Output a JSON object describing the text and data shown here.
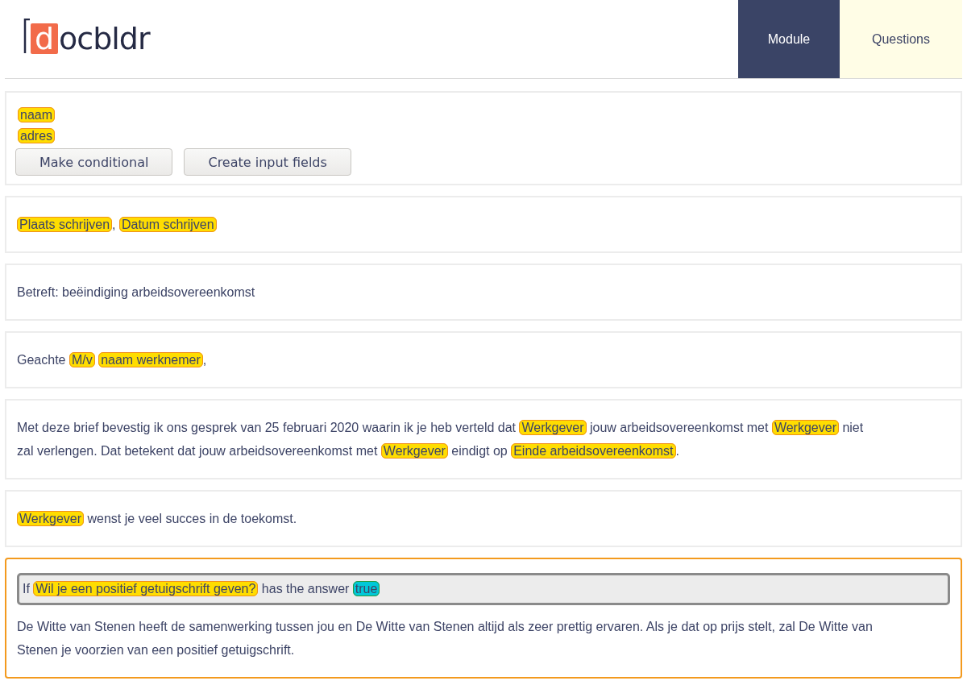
{
  "logo": {
    "mark": "d",
    "text": "ocbldr"
  },
  "tabs": [
    {
      "label": "Module",
      "selected": true
    },
    {
      "label": "Questions",
      "selected": false
    }
  ],
  "blocks": [
    {
      "kind": "fields",
      "selected": false,
      "tags": [
        "naam",
        "adres"
      ],
      "buttons": [
        "Make conditional",
        "Create input fields"
      ]
    },
    {
      "kind": "paragraph",
      "selected": false,
      "segments": [
        {
          "kind": "tag",
          "text": "Plaats schrijven"
        },
        {
          "kind": "text",
          "text": ","
        },
        {
          "kind": "tag",
          "text": "Datum schrijven"
        }
      ]
    },
    {
      "kind": "paragraph",
      "selected": false,
      "segments": [
        {
          "kind": "text",
          "text": "Betreft: beëindiging arbeidsovereenkomst"
        }
      ]
    },
    {
      "kind": "paragraph",
      "selected": false,
      "segments": [
        {
          "kind": "text",
          "text": "Geachte"
        },
        {
          "kind": "tag",
          "text": "M/v"
        },
        {
          "kind": "tag",
          "text": "naam werknemer"
        },
        {
          "kind": "text",
          "text": ","
        }
      ]
    },
    {
      "kind": "paragraph",
      "selected": false,
      "segments": [
        {
          "kind": "text",
          "text": "Met deze brief bevestig ik ons gesprek van 25 februari 2020 waarin ik je heb verteld dat"
        },
        {
          "kind": "tag",
          "text": "Werkgever"
        },
        {
          "kind": "text",
          "text": "jouw arbeidsovereenkomst met"
        },
        {
          "kind": "tag",
          "text": "Werkgever"
        },
        {
          "kind": "text",
          "text": "niet"
        },
        {
          "kind": "text",
          "text": "zal verlengen. Dat betekent dat jouw arbeidsovereenkomst met"
        },
        {
          "kind": "tag",
          "text": "Werkgever"
        },
        {
          "kind": "text",
          "text": "eindigt op"
        },
        {
          "kind": "tag",
          "text": "Einde arbeidsovereenkomst"
        },
        {
          "kind": "text",
          "text": "."
        }
      ]
    },
    {
      "kind": "paragraph",
      "selected": false,
      "segments": [
        {
          "kind": "tag",
          "text": "Werkgever"
        },
        {
          "kind": "text",
          "text": "wenst je veel succes in de toekomst."
        }
      ]
    },
    {
      "kind": "conditional",
      "selected": true,
      "condition": [
        {
          "kind": "text",
          "text": "If"
        },
        {
          "kind": "tag",
          "text": "Wil je een positief getuigschrift geven?"
        },
        {
          "kind": "text",
          "text": "has the answer"
        },
        {
          "kind": "answer",
          "text": "true"
        }
      ],
      "segments": [
        {
          "kind": "text",
          "text": "De Witte van Stenen heeft de samenwerking tussen jou en De Witte van Stenen altijd als zeer prettig ervaren. Als je dat op prijs stelt, zal De Witte van"
        },
        {
          "kind": "text",
          "text": "Stenen je voorzien van een positief getuigschrift."
        }
      ]
    }
  ]
}
